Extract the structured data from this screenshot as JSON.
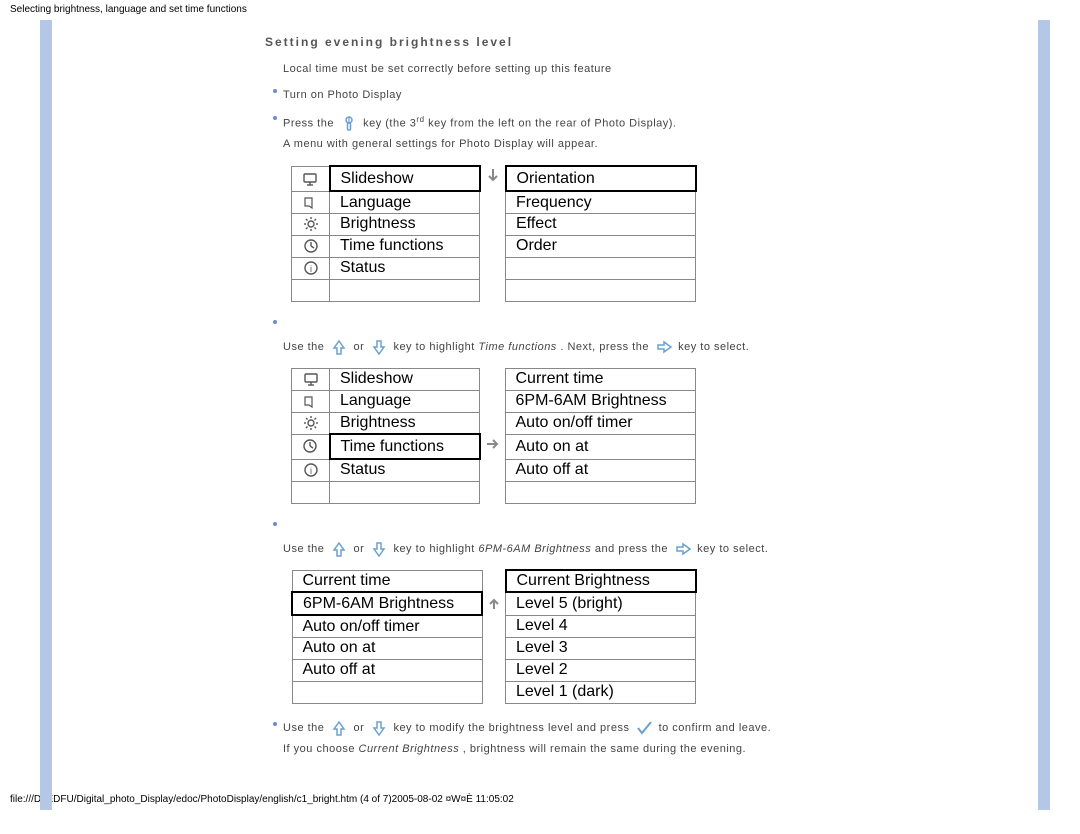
{
  "header_small": "Selecting brightness, language and set time functions",
  "heading": "Setting evening brightness level",
  "intro": "Local time must be set correctly before setting up this feature",
  "steps": {
    "s1": "Turn on Photo Display",
    "s2a": "Press the ",
    "s2b": " key (the 3",
    "s2sup": "rd",
    "s2c": " key from the left on the rear of Photo Display).",
    "s2d": "A menu with general settings for Photo Display will appear.",
    "s3a": "Use the ",
    "s3b": " or ",
    "s3c": " key to highlight ",
    "s3d": "Time functions",
    "s3e": ". Next, press the ",
    "s3f": " key to select.",
    "s4a": "Use the ",
    "s4b": " or ",
    "s4c": " key to highlight ",
    "s4d": "6PM-6AM Brightness",
    "s4e": " and press the",
    "s4f": " key to select.",
    "s5a": "Use the ",
    "s5b": " or ",
    "s5c": " key to modify the brightness level and press ",
    "s5d": " to confirm and leave.",
    "s5e": "If you choose ",
    "s5f": "Current Brightness",
    "s5g": ", brightness will remain the same during the evening."
  },
  "menu1": {
    "left": [
      "Slideshow",
      "Language",
      "Brightness",
      "Time functions",
      "Status"
    ],
    "right": [
      "Orientation",
      "Frequency",
      "Effect",
      "Order",
      ""
    ]
  },
  "menu2": {
    "left": [
      "Slideshow",
      "Language",
      "Brightness",
      "Time functions",
      "Status"
    ],
    "right": [
      "Current time",
      "6PM-6AM Brightness",
      "Auto on/off timer",
      "Auto on at",
      "Auto off at"
    ]
  },
  "menu3": {
    "left": [
      "Current time",
      "6PM-6AM Brightness",
      "Auto on/off timer",
      "Auto on at",
      "Auto off at",
      ""
    ],
    "right": [
      "Current Brightness",
      "Level 5 (bright)",
      "Level 4",
      "Level 3",
      "Level 2",
      "Level 1 (dark)"
    ]
  },
  "footer": "file:///D|/EDFU/Digital_photo_Display/edoc/PhotoDisplay/english/c1_bright.htm (4 of 7)2005-08-02 ¤W¤È 11:05:02"
}
